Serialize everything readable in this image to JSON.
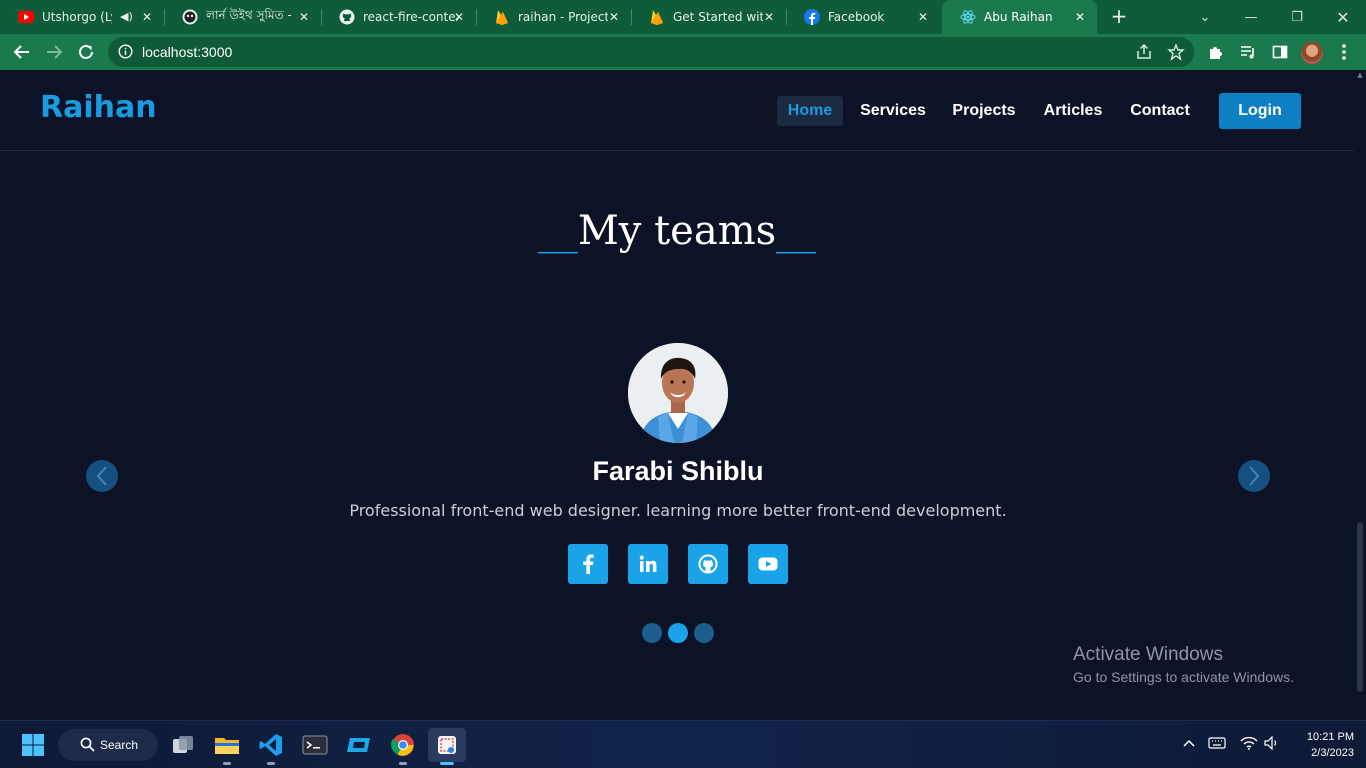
{
  "browser": {
    "tabs": [
      {
        "title": "Utshorgo (Lyrics)",
        "icon": "youtube-icon"
      },
      {
        "title": "লার্ন উইথ সুমিত -",
        "icon": "github-cat-icon"
      },
      {
        "title": "react-fire-context",
        "icon": "github-icon"
      },
      {
        "title": "raihan - Project s",
        "icon": "firebase-icon"
      },
      {
        "title": "Get Started with",
        "icon": "firebase-icon"
      },
      {
        "title": "Facebook",
        "icon": "facebook-icon"
      },
      {
        "title": "Abu Raihan",
        "icon": "react-icon"
      }
    ],
    "url": "localhost:3000"
  },
  "site": {
    "brand": "Raihan",
    "nav": [
      "Home",
      "Services",
      "Projects",
      "Articles",
      "Contact"
    ],
    "login": "Login"
  },
  "teams": {
    "title_prefix": "__",
    "title": "My teams",
    "title_suffix": "__",
    "member": {
      "name": "Farabi Shiblu",
      "description": "Professional front-end web designer. learning more better front-end development."
    },
    "social": [
      "facebook-icon",
      "linkedin-icon",
      "github-icon",
      "youtube-icon"
    ],
    "slides": 3,
    "active_slide": 2
  },
  "watermark": {
    "heading": "Activate Windows",
    "sub": "Go to Settings to activate Windows."
  },
  "taskbar": {
    "search": "Search",
    "time": "10:21 PM",
    "date": "2/3/2023"
  },
  "colors": {
    "accent": "#1a9be0",
    "browser_frame": "#1a7a4d",
    "page_bg": "#0c1327"
  }
}
